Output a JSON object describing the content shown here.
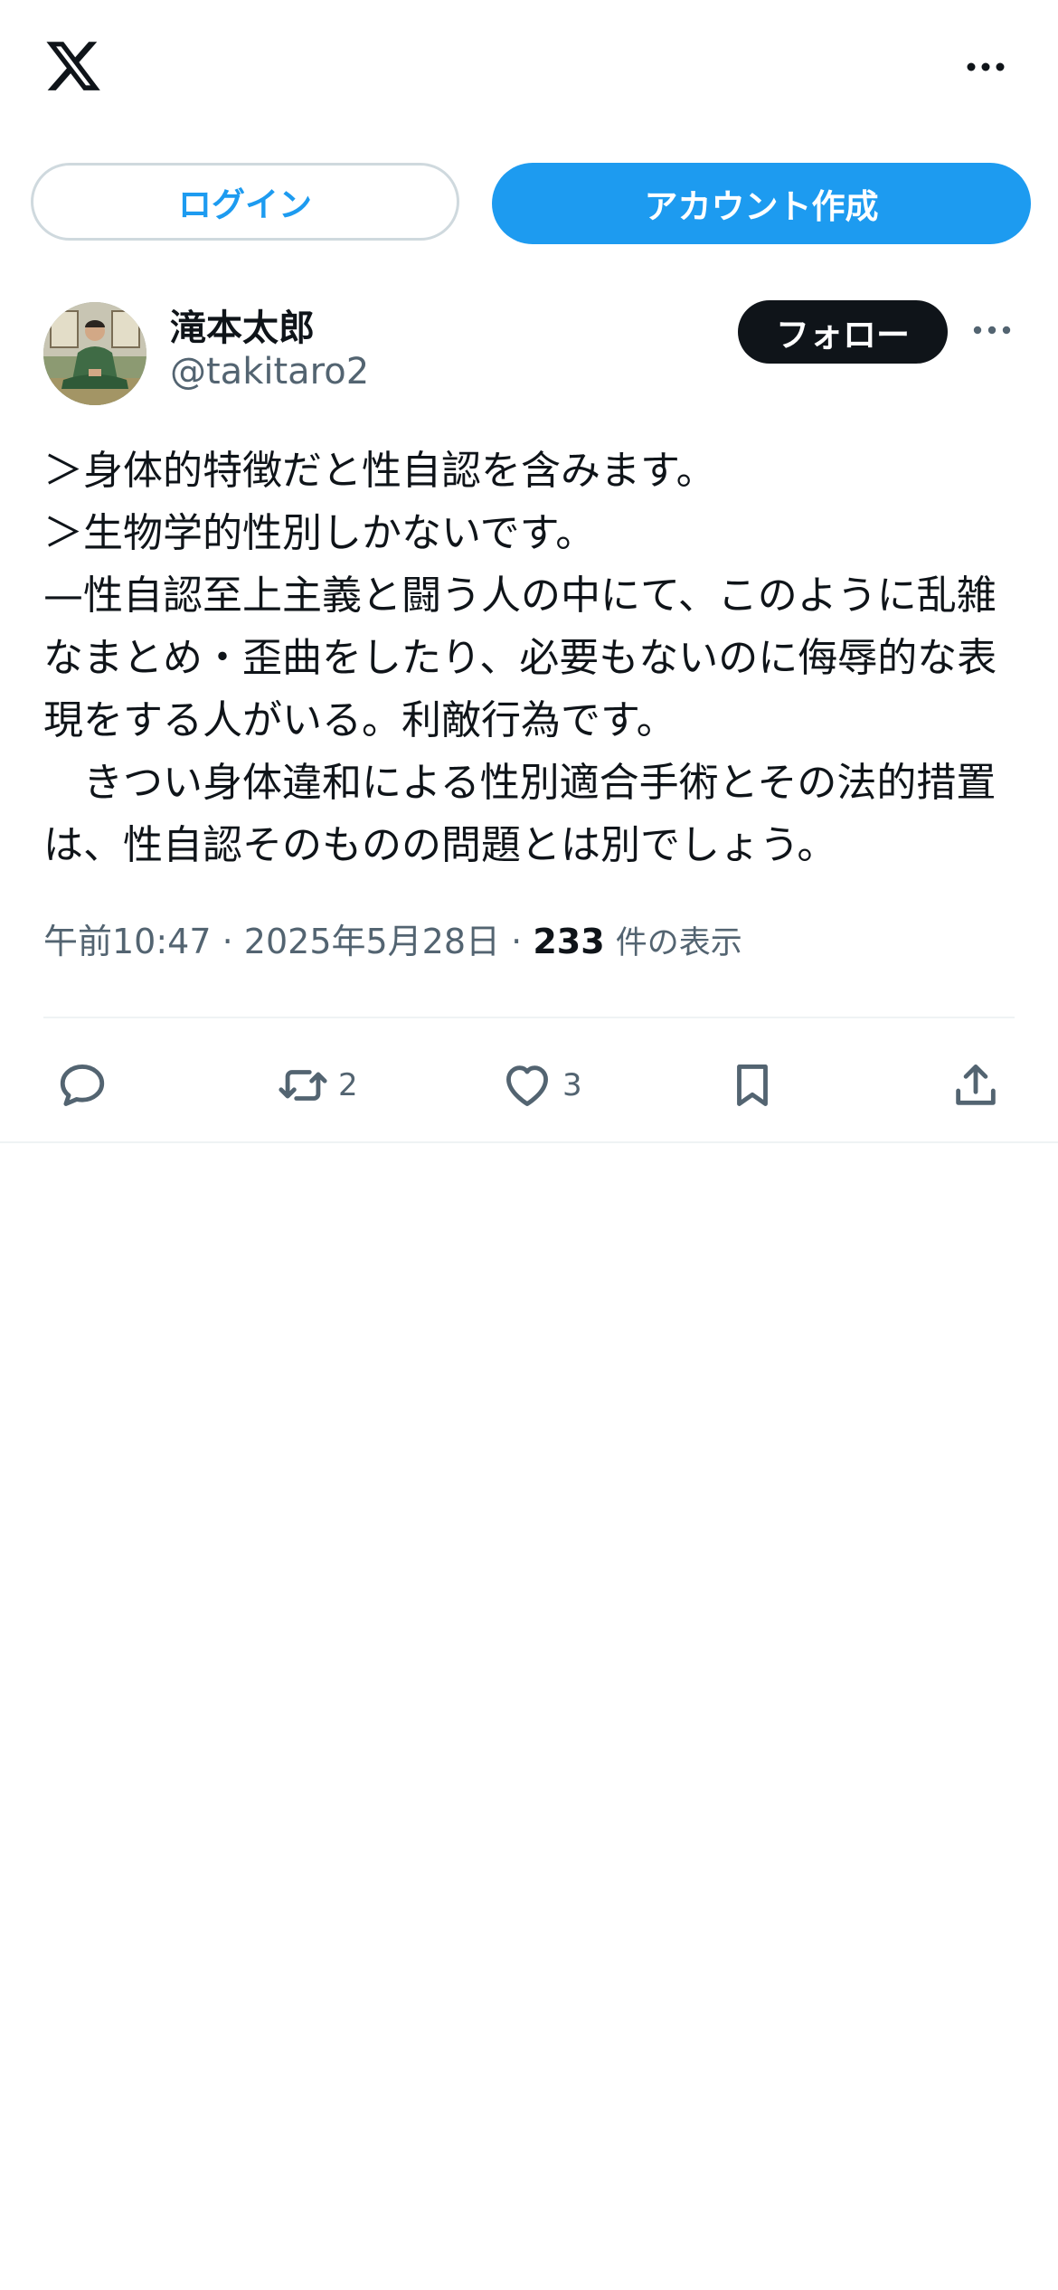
{
  "header": {
    "logo_icon": "x-logo-icon",
    "more_icon": "more-horizontal-icon"
  },
  "auth": {
    "login_label": "ログイン",
    "signup_label": "アカウント作成"
  },
  "post": {
    "author": {
      "name": "滝本太郎",
      "handle": "@takitaro2"
    },
    "follow_label": "フォロー",
    "text": "＞身体的特徴だと性自認を含みます。\n＞生物学的性別しかないです。\n—性自認至上主義と闘う人の中にて、このように乱雑なまとめ・歪曲をしたり、必要もないのに侮辱的な表現をする人がいる。利敵行為です。\n　きつい身体違和による性別適合手術とその法的措置は、性自認そのものの問題とは別でしょう。",
    "time": "午前10:47",
    "separator": "·",
    "date": "2025年5月28日",
    "views_count": "233",
    "views_label": "件の表示",
    "actions": {
      "reply_icon": "reply-icon",
      "repost_icon": "repost-icon",
      "repost_count": "2",
      "like_icon": "heart-icon",
      "like_count": "3",
      "bookmark_icon": "bookmark-icon",
      "share_icon": "share-icon"
    }
  },
  "colors": {
    "accent": "#1d9bf0",
    "text": "#0f1419",
    "secondary": "#536471",
    "border": "#cfd9de"
  }
}
